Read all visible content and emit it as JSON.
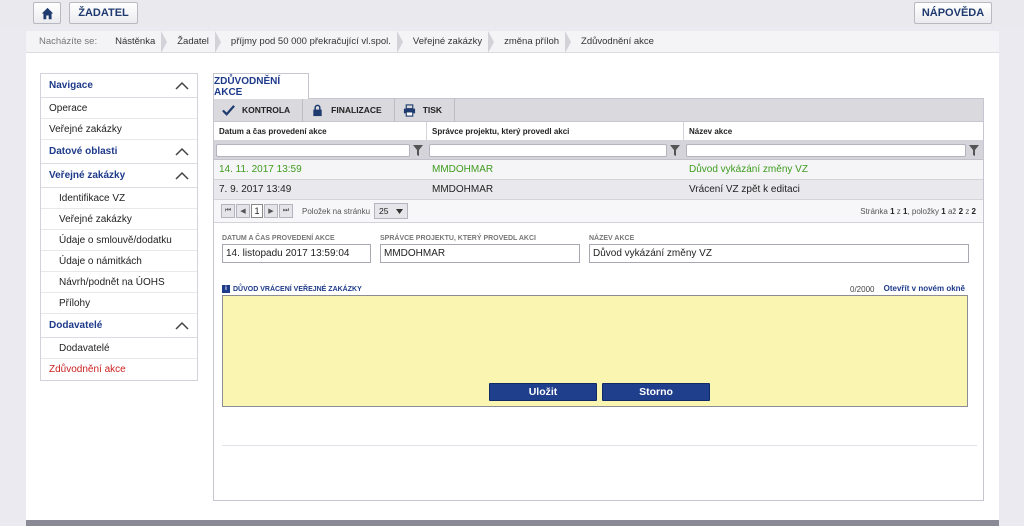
{
  "topbar": {
    "home_icon": "home-icon",
    "zadatel_label": "ŽADATEL",
    "napoveda_label": "NÁPOVĚDA"
  },
  "breadcrumb": {
    "label": "Nacházíte se:",
    "items": [
      "Nástěnka",
      "Žadatel",
      "příjmy pod 50 000 překračující vl.spol.",
      "Veřejné zakázky",
      "změna příloh",
      "Zdůvodnění akce"
    ]
  },
  "sidebar": {
    "navigace": "Navigace",
    "operace": "Operace",
    "verejne_zakazky": "Veřejné zakázky",
    "datove_oblasti": "Datové oblasti",
    "verejne_zakazky_section": "Veřejné zakázky",
    "sub_items": [
      "Identifikace VZ",
      "Veřejné zakázky",
      "Údaje o smlouvě/dodatku",
      "Údaje o námitkách",
      "Návrh/podnět na ÚOHS",
      "Přílohy"
    ],
    "dodavatele_section": "Dodavatelé",
    "dodavatele_item": "Dodavatelé",
    "zduvodneni": "Zdůvodnění akce"
  },
  "tab": {
    "label": "ZDŮVODNĚNÍ AKCE"
  },
  "toolbar": {
    "kontrola": "KONTROLA",
    "finalizace": "FINALIZACE",
    "tisk": "TISK"
  },
  "grid": {
    "headers": [
      "Datum a čas provedení akce",
      "Správce projektu, který provedl akci",
      "Název akce"
    ],
    "rows": [
      [
        "14. 11. 2017 13:59",
        "MMDOHMAR",
        "Důvod vykázání změny VZ"
      ],
      [
        "7. 9. 2017 13:49",
        "MMDOHMAR",
        "Vrácení VZ zpět k editaci"
      ]
    ]
  },
  "pager": {
    "first": "⏮",
    "prev": "◀",
    "page": "1",
    "next": "▶",
    "last": "⏭",
    "per_page_label": "Položek na stránku",
    "per_page_value": "25",
    "info_prefix": "Stránka",
    "info_page": "1",
    "info_of": "z",
    "info_pages": "1",
    "info_items_label": ", položky",
    "info_from": "1",
    "info_to_label": "až",
    "info_to": "2",
    "info_of2": "z",
    "info_total": "2"
  },
  "form": {
    "datum_label": "DATUM A ČAS PROVEDENÍ AKCE",
    "datum_value": "14. listopadu 2017 13:59:04",
    "spravce_label": "SPRÁVCE PROJEKTU, KTERÝ PROVEDL AKCI",
    "spravce_value": "MMDOHMAR",
    "nazev_label": "NÁZEV AKCE",
    "nazev_value": "Důvod vykázání změny VZ",
    "reason_label": "DŮVOD VRÁCENÍ VEŘEJNÉ ZAKÁZKY",
    "counter": "0/2000",
    "open_link": "Otevřít v novém okně",
    "reason_value": ""
  },
  "actions": {
    "save": "Uložit",
    "storno": "Storno"
  },
  "colors": {
    "primary": "#1f3f8c",
    "active_red": "#cc2222",
    "selected_green": "#3e9c1e",
    "textarea_bg": "#fbf5b2"
  }
}
